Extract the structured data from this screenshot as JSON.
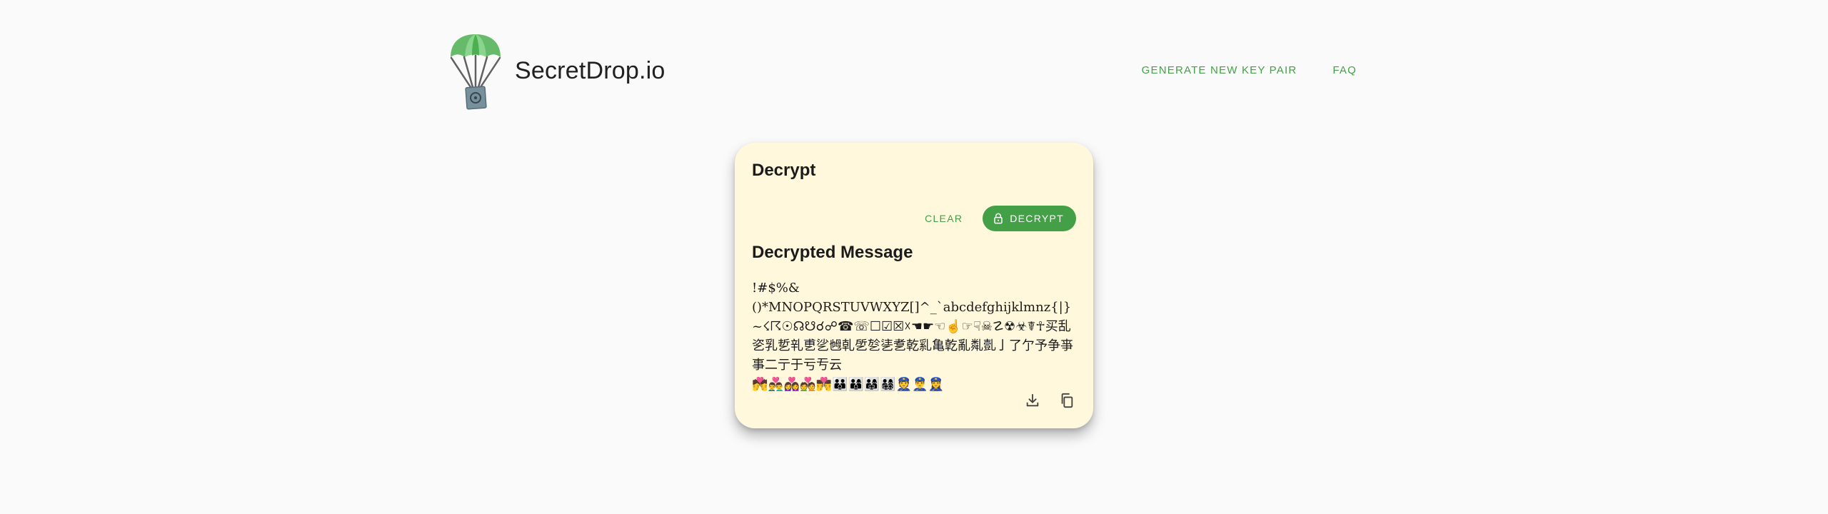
{
  "header": {
    "brand": "SecretDrop.io",
    "nav": {
      "generate_label": "GENERATE NEW KEY PAIR",
      "faq_label": "FAQ"
    }
  },
  "card": {
    "title": "Decrypt",
    "clear_label": "CLEAR",
    "decrypt_label": "DECRYPT",
    "section_title": "Decrypted Message",
    "message": "!#$%&\n()*MNOPQRSTUVWXYZ[]^_`abcdefghijklmnz{|}~☇☈☉☊☋☌☍☎☏☐☑☒☓☚☛☜☝☞☟☠☡☢☣☤☥买乱乲乳乴乵乶乷乸乹乺乻乼乽乾乿亀亁亂亃亄亅了亇予争亊事二亍于亏亐云\n💏👨‍❤️‍👨👩‍❤️‍👩💑👨‍❤️‍💋‍👨👪👨‍👩‍👦👨‍👩‍👧👨‍👩‍👧‍👦👮👮‍♂️👮‍♀️",
    "download_icon": "download-icon",
    "copy_icon": "copy-icon"
  },
  "colors": {
    "accent": "#43a047",
    "card_bg": "#fff8dc",
    "page_bg": "#fafafa"
  }
}
